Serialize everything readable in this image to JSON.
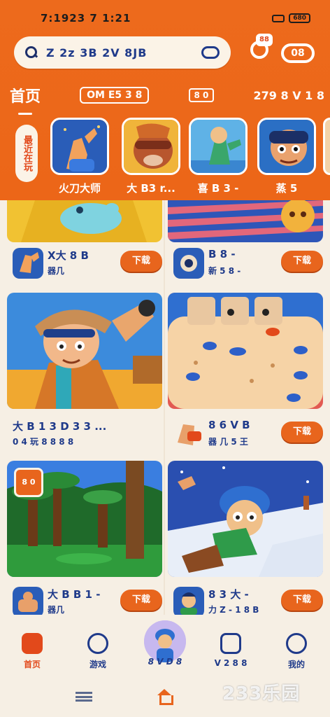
{
  "status": {
    "time": "7:1923 7 1:21",
    "battery": "680"
  },
  "search": {
    "placeholder": "Z 2z 3B 2V 8JB"
  },
  "header_icons": {
    "gift_badge": "88",
    "games_badge": "08"
  },
  "categories": [
    {
      "label": "首页"
    },
    {
      "label": "OM E5 3 8"
    },
    {
      "label": "8 0"
    },
    {
      "label": "279 8 V 1 8"
    }
  ],
  "recent_label": "最近在玩",
  "recent_games": [
    {
      "name": "火刀大师"
    },
    {
      "name": "大 B3 r..."
    },
    {
      "name": "喜 B 3 -"
    },
    {
      "name": "蒸 5"
    }
  ],
  "cards": [
    {
      "title": "X大 8 B",
      "subtitle": "器几",
      "button": "下载"
    },
    {
      "title": "B 8 -",
      "subtitle": "新 5 8 -",
      "button": "下载"
    },
    {
      "title": "大 B 1 3 D 3 3 ...",
      "subtitle": "0 4 玩 8 8 8 8",
      "button": "下载"
    },
    {
      "title": "8 6 V B",
      "subtitle": "器 几 5 王",
      "button": "下载"
    },
    {
      "title": "大 B B 1 -",
      "subtitle": "器几",
      "button": "下载"
    },
    {
      "title": "8 3 大 -",
      "subtitle": "力 Z - 1 8 B",
      "button": "下载"
    }
  ],
  "card_badge": "8 0",
  "nav": [
    {
      "label": "首页"
    },
    {
      "label": "游戏"
    },
    {
      "label": "8 V D 8"
    },
    {
      "label": "V 2 8 8"
    },
    {
      "label": "我的"
    }
  ],
  "watermark": "233乐园",
  "colors": {
    "brand_orange": "#ec6618",
    "accent_blue": "#1f3a8a",
    "background": "#f6efe4"
  }
}
